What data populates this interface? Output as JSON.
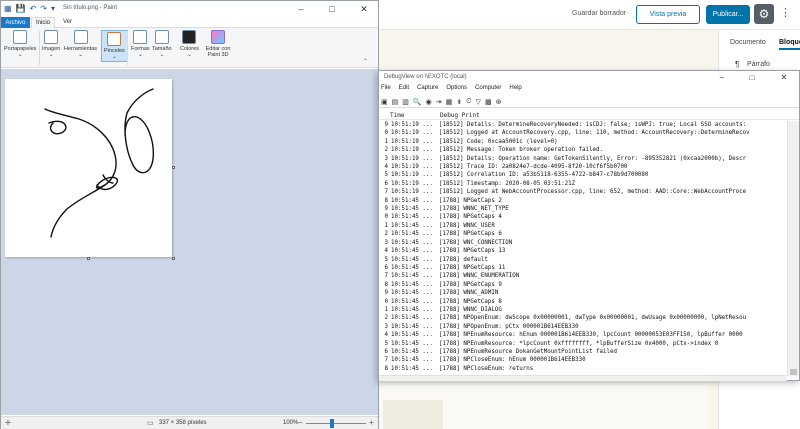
{
  "wordpress": {
    "save_draft": "Guardar borrador",
    "preview": "Vista previa",
    "publish": "Publicar...",
    "sidebar_tabs": [
      "Documento",
      "Bloque"
    ],
    "block_type": "Párrafo",
    "accent": "#0073aa"
  },
  "paint": {
    "title": "Sin título.png - Paint",
    "menu": {
      "file": "Archivo",
      "home": "Inicio",
      "view": "Ver"
    },
    "ribbon": {
      "clipboard": "Portapapeles",
      "image": "Imagen",
      "tools": "Herramientas",
      "brushes": "Pinceles",
      "shapes": "Formas",
      "size": "Tamaño",
      "colors": "Colores",
      "paint3d": "Editar con Paint 3D"
    },
    "status": {
      "dimensions": "337 × 358 píxeles",
      "zoom": "100%"
    }
  },
  "debugview": {
    "title": "DebugView on \\\\EXOTC (local)",
    "menu": [
      "File",
      "Edit",
      "Capture",
      "Options",
      "Computer",
      "Help"
    ],
    "columns": {
      "time": "Time",
      "print": "Debug Print"
    },
    "rows": [
      {
        "n": "9",
        "t": "10:51:19 ...",
        "m": "[18512] Details: DetermineRecoveryNeeded: isCDJ: false; isWPJ: true; Local SSO accounts:"
      },
      {
        "n": "0",
        "t": "10:51:19 ...",
        "m": "[18512] Logged at AccountRecovery.cpp, line: 110, method: AccountRecovery::DetermineRecov"
      },
      {
        "n": "1",
        "t": "10:51:19 ...",
        "m": "[18512] Code: 0xcaa5001c (level=0)"
      },
      {
        "n": "2",
        "t": "10:51:19 ...",
        "m": "[18512] Message: Token broker operation failed."
      },
      {
        "n": "3",
        "t": "10:51:19 ...",
        "m": "[18512] Details: Operation name: GetTokenSilently, Error: -895352821 (0xcaa2000b), Descr"
      },
      {
        "n": "4",
        "t": "10:51:19 ...",
        "m": "[18512] Trace ID: 2a0824e7-dcde-4095-8f20-10cf6f5b0700"
      },
      {
        "n": "5",
        "t": "10:51:19 ...",
        "m": "[18512] Correlation ID: a53b5118-6355-4722-b847-c78b9d700080"
      },
      {
        "n": "6",
        "t": "10:51:19 ...",
        "m": "[18512] Timestamp: 2020-08-05 03:51:21Z"
      },
      {
        "n": "7",
        "t": "10:51:19 ...",
        "m": "[18512] Logged at WebAccountProcessor.cpp, line: 652, method: AAD::Core::WebAccountProce"
      },
      {
        "n": "8",
        "t": "10:51:45 ...",
        "m": "[1788] NPGetCaps 2"
      },
      {
        "n": "9",
        "t": "10:51:45 ...",
        "m": "[1788]   WNNC_NET_TYPE"
      },
      {
        "n": "0",
        "t": "10:51:45 ...",
        "m": "[1788] NPGetCaps 4"
      },
      {
        "n": "1",
        "t": "10:51:45 ...",
        "m": "[1788]   WNNC_USER"
      },
      {
        "n": "2",
        "t": "10:51:45 ...",
        "m": "[1788] NPGetCaps 6"
      },
      {
        "n": "3",
        "t": "10:51:45 ...",
        "m": "[1788]   WNC_CONNECTION"
      },
      {
        "n": "4",
        "t": "10:51:45 ...",
        "m": "[1788] NPGetCaps 13"
      },
      {
        "n": "5",
        "t": "10:51:45 ...",
        "m": "[1788]   default"
      },
      {
        "n": "6",
        "t": "10:51:45 ...",
        "m": "[1788] NPGetCaps 11"
      },
      {
        "n": "7",
        "t": "10:51:45 ...",
        "m": "[1788]   WNNC_ENUMERATION"
      },
      {
        "n": "8",
        "t": "10:51:45 ...",
        "m": "[1788] NPGetCaps 9"
      },
      {
        "n": "9",
        "t": "10:51:45 ...",
        "m": "[1788]   WNNC_ADMIN"
      },
      {
        "n": "0",
        "t": "10:51:45 ...",
        "m": "[1788] NPGetCaps 8"
      },
      {
        "n": "1",
        "t": "10:51:45 ...",
        "m": "[1788]   WNNC_DIALOG"
      },
      {
        "n": "2",
        "t": "10:51:45 ...",
        "m": "[1788] NPOpenEnum: dwScope 0x00000001, dwType 0x00000001, dwUsage 0x00000000, lpNetResou"
      },
      {
        "n": "3",
        "t": "10:51:45 ...",
        "m": "[1788] NPOpenEnum: pCtx 000001B614EEB330"
      },
      {
        "n": "4",
        "t": "10:51:45 ...",
        "m": "[1788] NPEnumResource: hEnum 000001B614EEB330, lpcCount 00000053E03FF150, lpBuffer 0000"
      },
      {
        "n": "5",
        "t": "10:51:45 ...",
        "m": "[1788] NPEnumResource: *lpcCount 0xffffffff, *lpBufferSize 0x4000, pCtx->index 0"
      },
      {
        "n": "6",
        "t": "10:51:45 ...",
        "m": "[1788] NPEnumResource DokanGetMountPointList failed"
      },
      {
        "n": "7",
        "t": "10:51:45 ...",
        "m": "[1788] NPCloseEnum: hEnum 000001B614EEB330"
      },
      {
        "n": "8",
        "t": "10:51:45 ...",
        "m": "[1788] NPCloseEnum: returns"
      }
    ]
  }
}
